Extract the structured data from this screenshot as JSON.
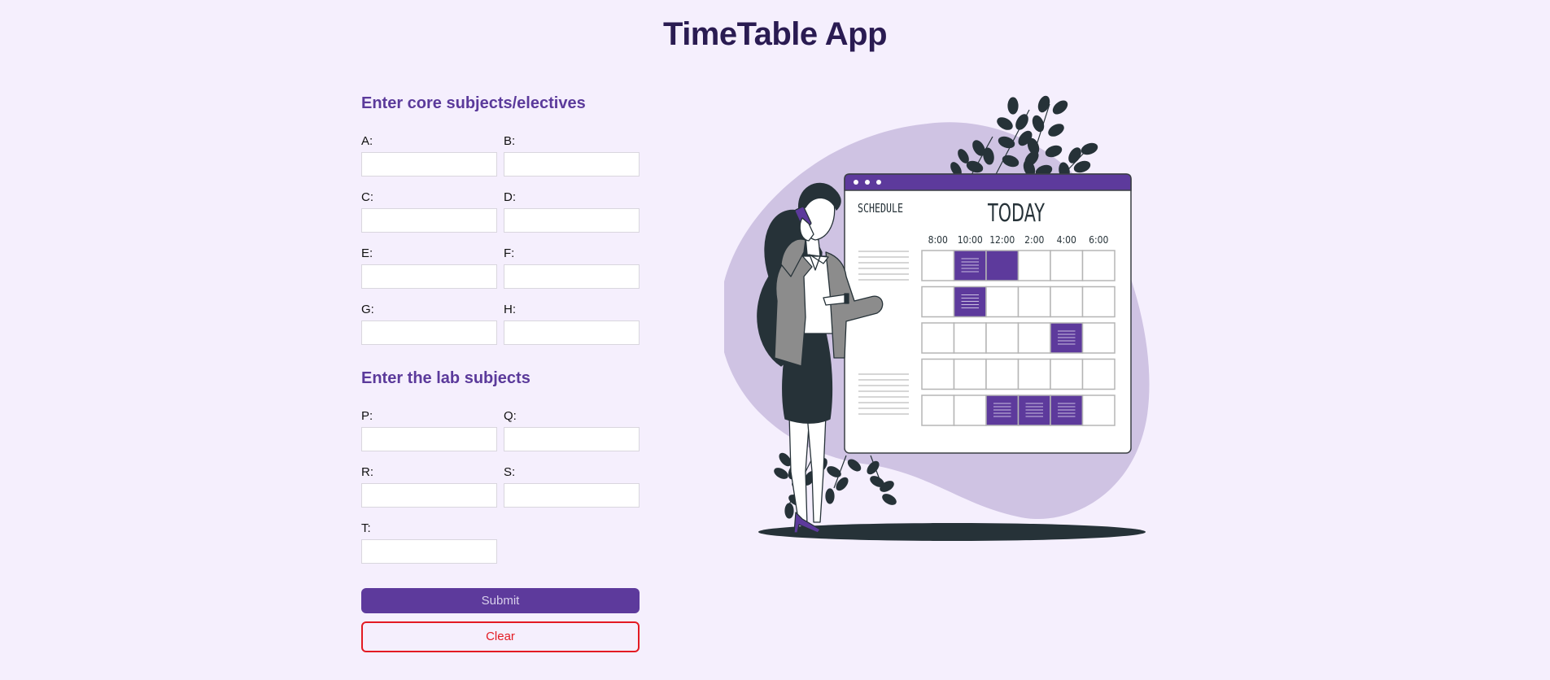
{
  "header": {
    "title": "TimeTable App"
  },
  "core_section": {
    "title": "Enter core subjects/electives",
    "fields": [
      {
        "label": "A:",
        "value": "",
        "placeholder": ""
      },
      {
        "label": "B:",
        "value": "",
        "placeholder": ""
      },
      {
        "label": "C:",
        "value": "",
        "placeholder": ""
      },
      {
        "label": "D:",
        "value": "",
        "placeholder": ""
      },
      {
        "label": "E:",
        "value": "",
        "placeholder": ""
      },
      {
        "label": "F:",
        "value": "",
        "placeholder": ""
      },
      {
        "label": "G:",
        "value": "",
        "placeholder": ""
      },
      {
        "label": "H:",
        "value": "",
        "placeholder": ""
      }
    ]
  },
  "lab_section": {
    "title": "Enter the lab subjects",
    "fields": [
      {
        "label": "P:",
        "value": "",
        "placeholder": ""
      },
      {
        "label": "Q:",
        "value": "",
        "placeholder": ""
      },
      {
        "label": "R:",
        "value": "",
        "placeholder": ""
      },
      {
        "label": "S:",
        "value": "",
        "placeholder": ""
      },
      {
        "label": "T:",
        "value": "",
        "placeholder": ""
      }
    ]
  },
  "actions": {
    "submit_label": "Submit",
    "clear_label": "Clear"
  },
  "illustration": {
    "schedule_label": "SCHEDULE",
    "today_label": "TODAY",
    "times": [
      "8:00",
      "10:00",
      "12:00",
      "2:00",
      "4:00",
      "6:00"
    ],
    "grid": [
      [
        0,
        2,
        1,
        0,
        0,
        0
      ],
      [
        0,
        2,
        0,
        0,
        0,
        0
      ],
      [
        0,
        0,
        0,
        0,
        2,
        0
      ],
      [
        0,
        0,
        0,
        0,
        0,
        0
      ],
      [
        0,
        0,
        2,
        2,
        2,
        0
      ]
    ],
    "colors": {
      "accent": "#5d3a9c",
      "blob": "#cfc3e3",
      "dark": "#263238",
      "jacket": "#8c8c8c"
    }
  }
}
